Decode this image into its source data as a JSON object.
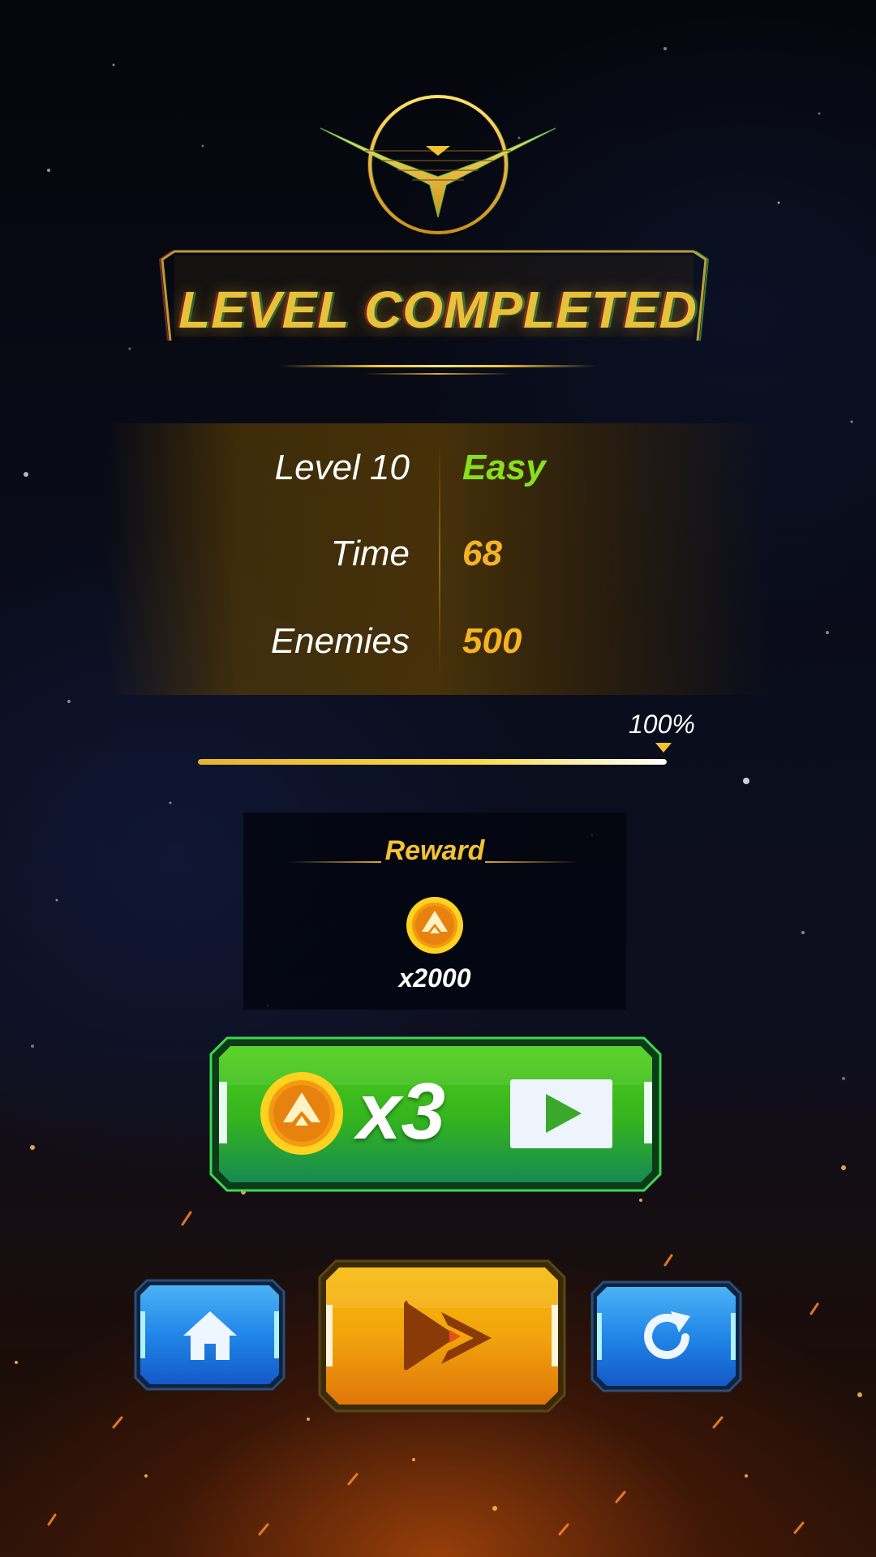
{
  "title": "LEVEL COMPLETED",
  "stats": {
    "level_label": "Level 10",
    "difficulty": "Easy",
    "time_label": "Time",
    "time_value": "68",
    "enemies_label": "Enemies",
    "enemies_value": "500"
  },
  "progress": {
    "label": "100%",
    "fraction": 1.0
  },
  "reward": {
    "title": "Reward",
    "amount": "x2000",
    "icon": "coin-icon"
  },
  "buttons": {
    "multiplier_label": "x3",
    "multiplier_icon": "video-play-icon",
    "home_icon": "home-icon",
    "next_icon": "fast-forward-icon",
    "retry_icon": "restart-icon"
  },
  "colors": {
    "gold": "#f3c232",
    "easy_green": "#86e01e",
    "value_orange": "#f5b324",
    "green_button": "#3fbf1e",
    "blue_button": "#1f7fe0",
    "orange_button": "#f0a20e"
  }
}
